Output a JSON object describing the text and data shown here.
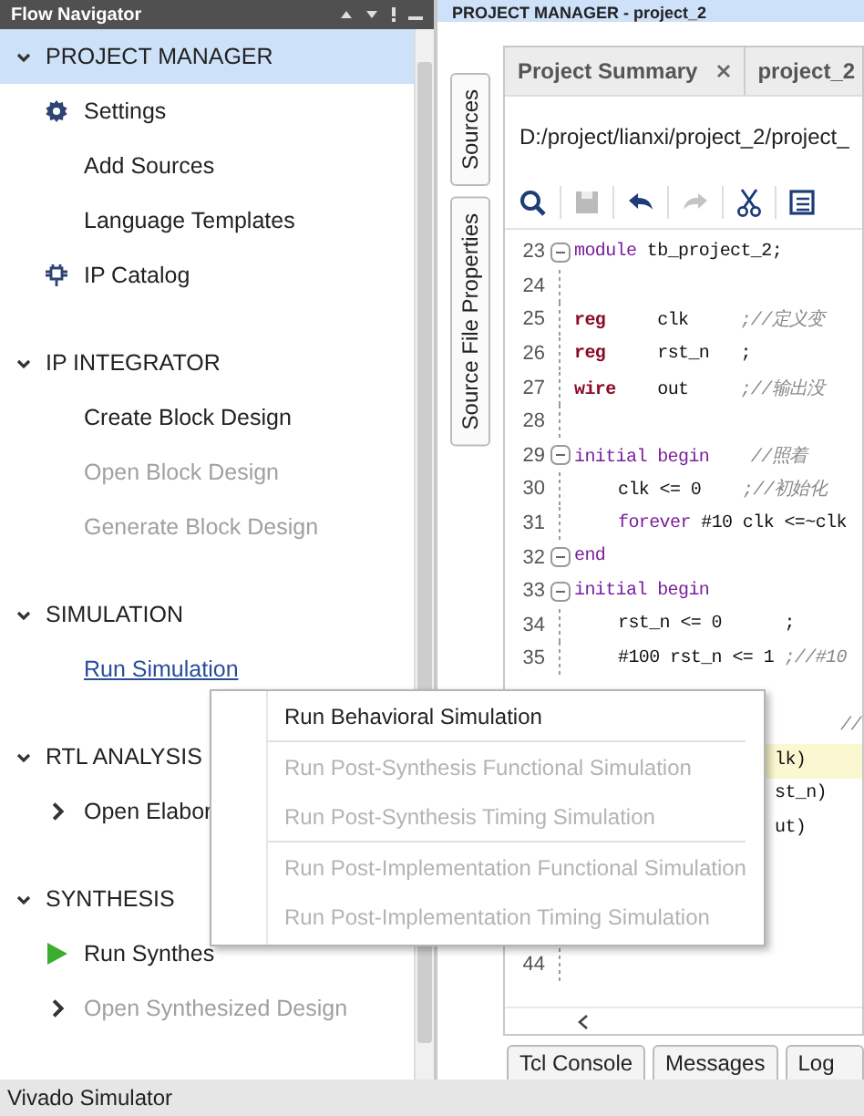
{
  "flow_navigator": {
    "title": "Flow Navigator",
    "sections": [
      {
        "title": "PROJECT MANAGER",
        "expanded": true,
        "selected": true,
        "items": [
          {
            "label": "Settings",
            "kind": "gear",
            "disabled": false
          },
          {
            "label": "Add Sources",
            "kind": "plain",
            "disabled": false
          },
          {
            "label": "Language Templates",
            "kind": "plain",
            "disabled": false
          },
          {
            "label": "IP Catalog",
            "kind": "chip",
            "disabled": false
          }
        ]
      },
      {
        "title": "IP INTEGRATOR",
        "expanded": true,
        "selected": false,
        "items": [
          {
            "label": "Create Block Design",
            "kind": "plain",
            "disabled": false
          },
          {
            "label": "Open Block Design",
            "kind": "plain",
            "disabled": true
          },
          {
            "label": "Generate Block Design",
            "kind": "plain",
            "disabled": true
          }
        ]
      },
      {
        "title": "SIMULATION",
        "expanded": true,
        "selected": false,
        "items": [
          {
            "label": "Run Simulation",
            "kind": "link",
            "disabled": false
          }
        ]
      },
      {
        "title": "RTL ANALYSIS",
        "expanded": true,
        "selected": false,
        "items": [
          {
            "label": "Open Elabor",
            "kind": "expandable",
            "disabled": false
          }
        ]
      },
      {
        "title": "SYNTHESIS",
        "expanded": true,
        "selected": false,
        "items": [
          {
            "label": "Run Synthes",
            "kind": "run",
            "disabled": false
          },
          {
            "label": "Open Synthesized Design",
            "kind": "expandable",
            "disabled": true
          }
        ]
      }
    ]
  },
  "panel": {
    "title": "PROJECT MANAGER - project_2"
  },
  "side_tabs": [
    "Sources",
    "Source File Properties"
  ],
  "editor": {
    "tabs": [
      {
        "label": "Project Summary",
        "closable": true
      },
      {
        "label": "project_2",
        "closable": false
      }
    ],
    "path": "D:/project/lianxi/project_2/project_",
    "lines": [
      {
        "number": "23",
        "kind": "fold-start",
        "highlighted": false,
        "segments": [
          {
            "kind": "keyword",
            "text": "module"
          },
          {
            "kind": "plain",
            "text": " tb_project_2;"
          }
        ]
      },
      {
        "number": "24",
        "kind": "body",
        "highlighted": false
      },
      {
        "number": "25",
        "kind": "body",
        "highlighted": false,
        "segments": [
          {
            "kind": "type",
            "text": "reg"
          },
          {
            "kind": "plain",
            "text": "     clk     "
          },
          {
            "kind": "comment",
            "text": ";//定义变"
          }
        ]
      },
      {
        "number": "26",
        "kind": "body",
        "highlighted": false,
        "segments": [
          {
            "kind": "type",
            "text": "reg"
          },
          {
            "kind": "plain",
            "text": "     rst_n   ;"
          }
        ]
      },
      {
        "number": "27",
        "kind": "body",
        "highlighted": false,
        "segments": [
          {
            "kind": "type",
            "text": "wire"
          },
          {
            "kind": "plain",
            "text": "    out     "
          },
          {
            "kind": "comment",
            "text": ";//输出没"
          }
        ]
      },
      {
        "number": "28",
        "kind": "body",
        "highlighted": false
      },
      {
        "number": "29",
        "kind": "fold-start",
        "highlighted": false,
        "segments": [
          {
            "kind": "keyword",
            "text": "initial begin"
          },
          {
            "kind": "comment",
            "text": "    //照着"
          }
        ]
      },
      {
        "number": "30",
        "kind": "body-indented",
        "highlighted": false,
        "segments": [
          {
            "kind": "plain",
            "text": "clk <= 0    "
          },
          {
            "kind": "comment",
            "text": ";//初始化"
          }
        ]
      },
      {
        "number": "31",
        "kind": "body-indented",
        "highlighted": false,
        "segments": [
          {
            "kind": "keyword",
            "text": "forever"
          },
          {
            "kind": "plain",
            "text": " #10 clk <=~clk"
          }
        ]
      },
      {
        "number": "32",
        "kind": "fold-start",
        "highlighted": false,
        "segments": [
          {
            "kind": "keyword",
            "text": "end"
          }
        ]
      },
      {
        "number": "33",
        "kind": "fold-start",
        "highlighted": false,
        "segments": [
          {
            "kind": "keyword",
            "text": "initial begin"
          }
        ]
      },
      {
        "number": "34",
        "kind": "body-indented",
        "highlighted": false,
        "segments": [
          {
            "kind": "plain",
            "text": "rst_n <= 0      ;"
          }
        ]
      },
      {
        "number": "35",
        "kind": "body-indented",
        "highlighted": false,
        "segments": [
          {
            "kind": "plain",
            "text": "#100 rst_n <= 1 "
          },
          {
            "kind": "comment",
            "text": ";//#10"
          }
        ]
      },
      {
        "kind": "covered",
        "highlighted": false
      },
      {
        "kind": "covered-far",
        "highlighted": false,
        "segments": [
          {
            "kind": "comment",
            "text": "//"
          }
        ]
      },
      {
        "kind": "covered",
        "highlighted": true,
        "segments": [
          {
            "kind": "plain",
            "text": "lk)"
          }
        ]
      },
      {
        "kind": "covered",
        "highlighted": false,
        "segments": [
          {
            "kind": "plain",
            "text": "st_n)"
          }
        ]
      },
      {
        "kind": "covered",
        "highlighted": false,
        "segments": [
          {
            "kind": "plain",
            "text": "ut)"
          }
        ]
      },
      {
        "kind": "covered",
        "highlighted": false
      },
      {
        "kind": "covered",
        "highlighted": false
      },
      {
        "kind": "body",
        "highlighted": false
      },
      {
        "number": "44",
        "kind": "body",
        "highlighted": false
      }
    ]
  },
  "bottom_tabs": [
    "Tcl Console",
    "Messages",
    "Log"
  ],
  "context_menu": {
    "groups": [
      {
        "items": [
          {
            "label": "Run Behavioral Simulation",
            "disabled": false
          }
        ]
      },
      {
        "items": [
          {
            "label": "Run Post-Synthesis Functional Simulation",
            "disabled": true
          },
          {
            "label": "Run Post-Synthesis Timing Simulation",
            "disabled": true
          }
        ]
      },
      {
        "items": [
          {
            "label": "Run Post-Implementation Functional Simulation",
            "disabled": true
          },
          {
            "label": "Run Post-Implementation Timing Simulation",
            "disabled": true
          }
        ]
      }
    ]
  },
  "status_bar": {
    "text": "Vivado Simulator"
  }
}
